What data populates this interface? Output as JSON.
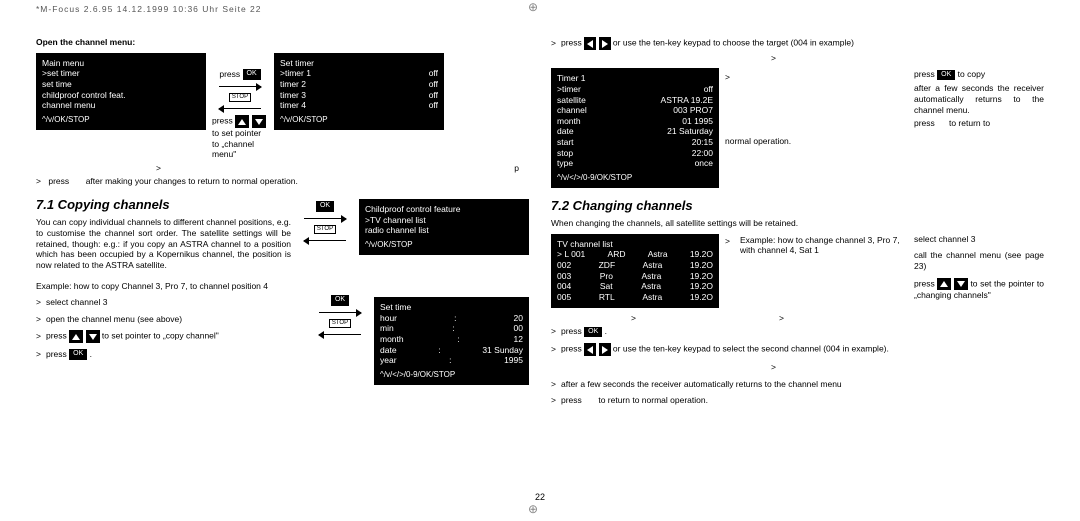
{
  "header": "*M-Focus 2.6.95   14.12.1999 10:36 Uhr   Seite 22",
  "pagenum": "22",
  "left": {
    "openTitle": "Open the channel menu:",
    "menu": {
      "title": "Main menu",
      "items": [
        "  >set timer",
        "   set time",
        "   childproof control feat.",
        "   channel menu"
      ],
      "foot": "^/v/OK/STOP"
    },
    "setTimer": {
      "title": "Set timer",
      "rows": [
        [
          "  >timer 1",
          "off"
        ],
        [
          "   timer 2",
          "off"
        ],
        [
          "   timer 3",
          "off"
        ],
        [
          "   timer 4",
          "off"
        ]
      ],
      "foot": "^/v/OK/STOP"
    },
    "press": "press",
    "pressP": "p",
    "toSet": " to set pointer to „channel menu\"",
    "afterChange": "after making your changes to return to normal operation.",
    "h71": "7.1  Copying channels",
    "copyBody": "You can copy individual channels to different channel positions, e.g. to customise the channel sort order. The satellite settings will be retained, though: e.g.: if you copy an ASTRA channel to a position which has been occupied by a Kopernikus channel, the position is now related to the ASTRA satellite.",
    "childproof": {
      "title": "Childproof control feature",
      "items": [
        "  >TV channel list",
        "   radio channel list"
      ],
      "foot": "^/v/OK/STOP"
    },
    "example": "Example: how to copy Channel 3, Pro 7, to channel position 4",
    "steps": {
      "s1": "select channel 3",
      "s2": "open the channel menu (see above)",
      "s3p": "press",
      "s3t": " to set pointer to „copy channel\"",
      "s4": "press"
    },
    "setTime": {
      "title": "Set time",
      "rows": [
        [
          "   hour",
          ":",
          "20"
        ],
        [
          "   min",
          ":",
          "00"
        ],
        [
          "   month",
          ":",
          "12"
        ],
        [
          "   date",
          ":",
          "31 Sunday"
        ],
        [
          "   year",
          ":",
          "1995"
        ]
      ],
      "foot": "^/v/</>/0-9/OK/STOP"
    }
  },
  "right": {
    "topLine": "or use the ten-key keypad to choose the target (004 in example)",
    "timer": {
      "title": "Timer 1",
      "rows": [
        [
          "  >timer",
          "off"
        ],
        [
          "   satellite",
          "ASTRA   19.2E"
        ],
        [
          "   channel",
          "003 PRO7"
        ],
        [
          "   month",
          "01   1995"
        ],
        [
          "   date",
          "21 Saturday"
        ],
        [
          "   start",
          "20:15"
        ],
        [
          "   stop",
          "22:00"
        ],
        [
          "   type",
          "once"
        ]
      ],
      "foot": "^/v/</>/0-9/OK/STOP"
    },
    "normal": "normal operation.",
    "toCopy": "to copy",
    "afterCopy": "after a few seconds the receiver automatically returns to the channel menu.",
    "toReturn": "to return to",
    "h72": "7.2  Changing channels",
    "changeIntro": "When changing the channels, all satellite settings will be retained.",
    "changeEx": "Example: how to change channel 3, Pro 7, with channel 4, Sat 1",
    "tvlist": {
      "title": "TV channel list",
      "rows": [
        [
          "> L  001",
          "ARD",
          "Astra",
          "19.2O"
        ],
        [
          "     002",
          "ZDF",
          "Astra",
          "19.2O"
        ],
        [
          "     003",
          "Pro",
          "Astra",
          "19.2O"
        ],
        [
          "     004",
          "Sat",
          "Astra",
          "19.2O"
        ],
        [
          "     005",
          "RTL",
          "Astra",
          "19.2O"
        ]
      ],
      "foot": ""
    },
    "right2": {
      "s1": "select channel 3",
      "s2": "call the channel menu (see page 23)",
      "s3p": "press",
      "s3t": " to set the pointer to „changing channels\""
    },
    "steps": {
      "s5": "press",
      "s6a": "press",
      "s6b": "or use the ten-key keypad to select the second channel (004 in example).",
      "s7": "after a few seconds the receiver automatically returns to the channel menu",
      "s8a": "press",
      "s8b": "to return to normal operation."
    }
  }
}
